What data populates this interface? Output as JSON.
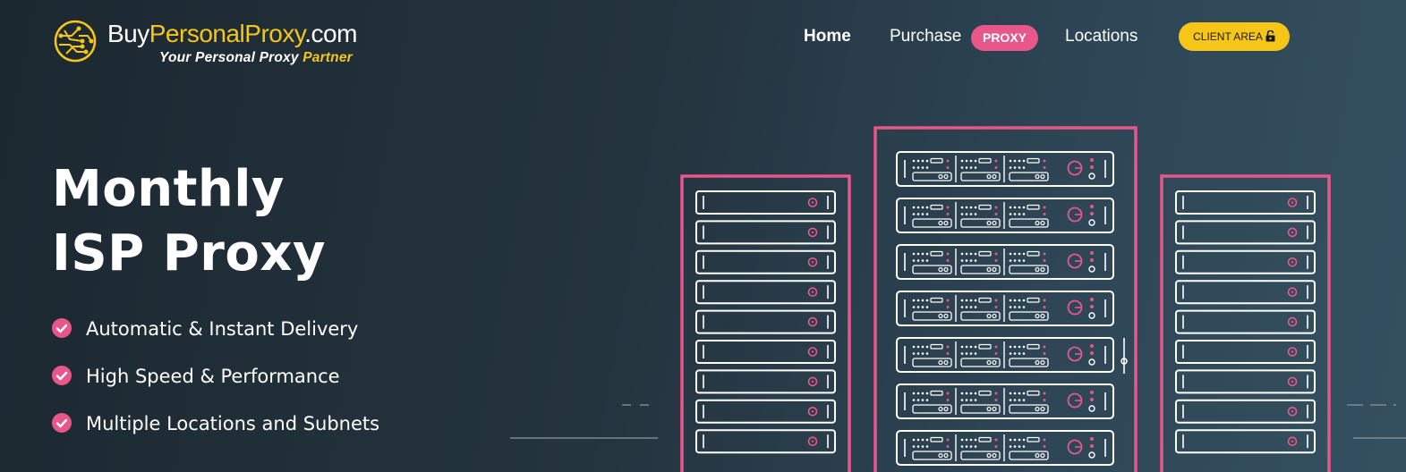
{
  "logo": {
    "brand_part1": "Buy",
    "brand_part2": "Personal",
    "brand_part3": "Proxy",
    "brand_part4": ".com",
    "tagline_part1": "Your Personal Proxy ",
    "tagline_part2": "Partner"
  },
  "nav": {
    "home": "Home",
    "purchase": "Purchase",
    "proxy_badge": "PROXY",
    "locations": "Locations",
    "client_area": "CLIENT AREA"
  },
  "hero": {
    "title_line1": "Monthly",
    "title_line2": "ISP Proxy",
    "features": [
      "Automatic & Instant Delivery",
      "High Speed & Performance",
      "Multiple Locations and Subnets"
    ]
  },
  "colors": {
    "accent_pink": "#e8578a",
    "accent_yellow": "#f5c518",
    "background": "#24343f"
  },
  "icons": {
    "logo": "circuit-globe-icon",
    "client_area": "unlock-icon",
    "feature": "check-circle-icon",
    "illustration": "server-rack-illustration"
  }
}
